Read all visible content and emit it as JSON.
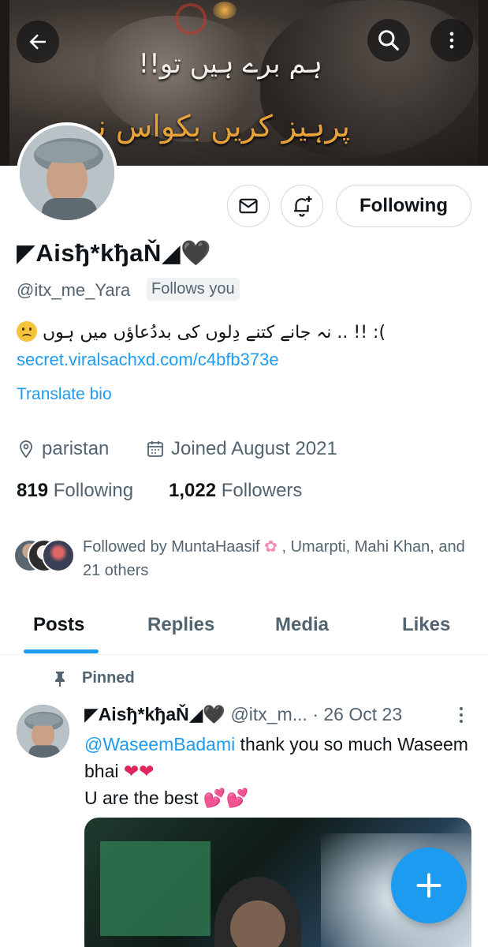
{
  "header": {
    "banner_line1": "ہم برے ہیں تو!!",
    "banner_line2": "پرہیز کریں بکواس نہیں"
  },
  "profile": {
    "display_name": "◤Aisђ*kђaŇ◢🖤",
    "handle": "@itx_me_Yara",
    "follows_you": "Follows you",
    "bio_text": "نہ جانے کتنے دِلوں کی بددُعاؤں میں ہوں .. !! :(",
    "bio_link": "secret.viralsachxd.com/c4bfb373e",
    "translate_label": "Translate bio",
    "location": "paristan",
    "joined": "Joined August 2021",
    "following_count": "819",
    "following_label": "Following",
    "followers_count": "1,022",
    "followers_label": "Followers",
    "followed_by_prefix": "Followed by MuntaHaasif",
    "followed_by_suffix": ", Umarpti, Mahi Khan, and 21 others"
  },
  "actions": {
    "follow_label": "Following"
  },
  "tabs": [
    {
      "label": "Posts"
    },
    {
      "label": "Replies"
    },
    {
      "label": "Media"
    },
    {
      "label": "Likes"
    }
  ],
  "tweet": {
    "pinned_label": "Pinned",
    "name": "◤Aisђ*kђaŇ◢🖤",
    "handle": "@itx_m...",
    "date": "· 26 Oct 23",
    "mention": "@WaseemBadami",
    "text1": "thank you so much Waseem bhai",
    "text2": "U are the best"
  },
  "icons": {
    "back": "arrow-left-icon",
    "search": "search-icon",
    "more": "more-vertical-icon",
    "message": "envelope-icon",
    "notify": "bell-plus-icon",
    "location": "map-pin-icon",
    "calendar": "calendar-icon",
    "pin": "pin-icon",
    "compose": "plus-icon"
  },
  "colors": {
    "accent": "#1d9bf0",
    "text": "#0f1419",
    "secondary": "#536471"
  }
}
